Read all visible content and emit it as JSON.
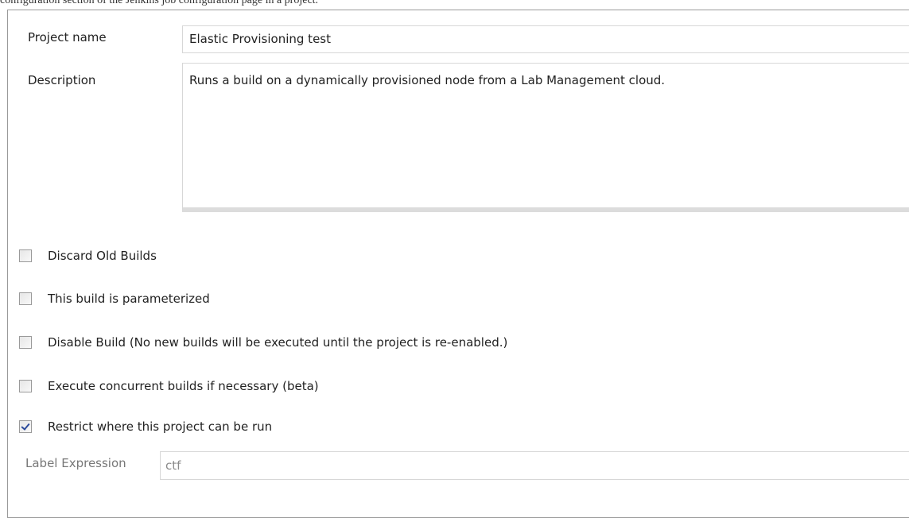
{
  "caption": "configuration section of the Jenkins job configuration page in a project.",
  "form": {
    "project_name_label": "Project name",
    "project_name_value": "Elastic Provisioning test",
    "description_label": "Description",
    "description_value": "Runs a build on a dynamically provisioned node from a Lab Management cloud."
  },
  "options": [
    {
      "label": "Discard Old Builds",
      "checked": false
    },
    {
      "label": "This build is parameterized",
      "checked": false
    },
    {
      "label": "Disable Build (No new builds will be executed until the project is re-enabled.)",
      "checked": false
    },
    {
      "label": "Execute concurrent builds if necessary (beta)",
      "checked": false
    },
    {
      "label": "Restrict where this project can be run",
      "checked": true
    }
  ],
  "label_expression": {
    "label": "Label Expression",
    "value": "ctf"
  },
  "colors": {
    "border": "#9a9a9a",
    "input_border": "#d7d7d7",
    "check_mark": "#2b4a9b",
    "muted_text": "#777777"
  }
}
